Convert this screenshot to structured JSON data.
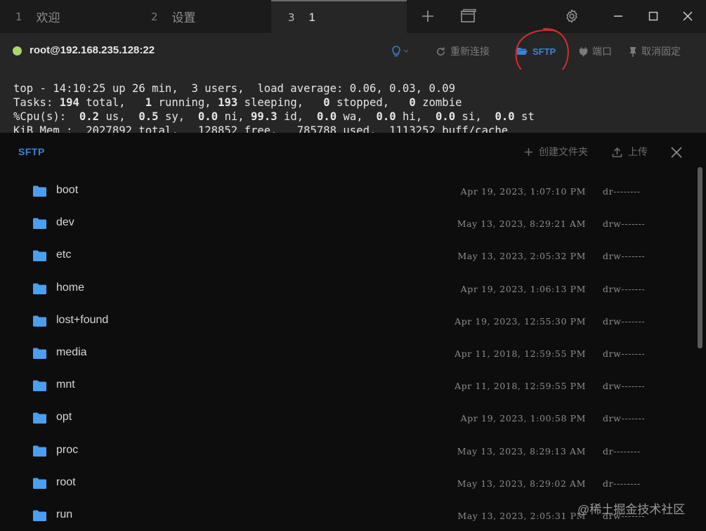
{
  "tabs": [
    {
      "num": "1",
      "label": "欢迎"
    },
    {
      "num": "2",
      "label": "设置"
    },
    {
      "num": "3",
      "label": "1"
    }
  ],
  "tabbar_icons": [
    "plus-icon",
    "window-icon",
    "gear-icon",
    "minimize-icon",
    "maximize-icon",
    "close-icon"
  ],
  "connection": {
    "host": "root@192.168.235.128:22",
    "status_color": "#a8d86a",
    "reconnect": "重新连接",
    "sftp": "SFTP",
    "port": "端口",
    "unpin": "取消固定"
  },
  "terminal": {
    "lines": [
      "top - 14:10:25 up 26 min,  3 users,  load average: 0.06, 0.03, 0.09",
      "Tasks: 194 total,   1 running, 193 sleeping,   0 stopped,   0 zombie",
      "%Cpu(s):  0.2 us,  0.5 sy,  0.0 ni, 99.3 id,  0.0 wa,  0.0 hi,  0.0 si,  0.0 st",
      "KiB Mem :  2027892 total,   128852 free,   785788 used,  1113252 buff/cache"
    ]
  },
  "sftp": {
    "title": "SFTP",
    "new_folder": "创建文件夹",
    "upload": "上传",
    "files": [
      {
        "name": "boot",
        "date": "Apr 19, 2023, 1:07:10 PM",
        "perm": "dr--------"
      },
      {
        "name": "dev",
        "date": "May 13, 2023, 8:29:21 AM",
        "perm": "drw-------"
      },
      {
        "name": "etc",
        "date": "May 13, 2023, 2:05:32 PM",
        "perm": "drw-------"
      },
      {
        "name": "home",
        "date": "Apr 19, 2023, 1:06:13 PM",
        "perm": "drw-------"
      },
      {
        "name": "lost+found",
        "date": "Apr 19, 2023, 12:55:30 PM",
        "perm": "drw-------"
      },
      {
        "name": "media",
        "date": "Apr 11, 2018, 12:59:55 PM",
        "perm": "drw-------"
      },
      {
        "name": "mnt",
        "date": "Apr 11, 2018, 12:59:55 PM",
        "perm": "drw-------"
      },
      {
        "name": "opt",
        "date": "Apr 19, 2023, 1:00:58 PM",
        "perm": "drw-------"
      },
      {
        "name": "proc",
        "date": "May 13, 2023, 8:29:13 AM",
        "perm": "dr--------"
      },
      {
        "name": "root",
        "date": "May 13, 2023, 8:29:02 AM",
        "perm": "dr--------"
      },
      {
        "name": "run",
        "date": "May 13, 2023, 2:05:31 PM",
        "perm": "drw-------"
      }
    ]
  },
  "watermark": "@稀土掘金技术社区",
  "colors": {
    "accent": "#3b82d6",
    "annotation": "#d92b2b",
    "folder": "#4a9ff0"
  }
}
